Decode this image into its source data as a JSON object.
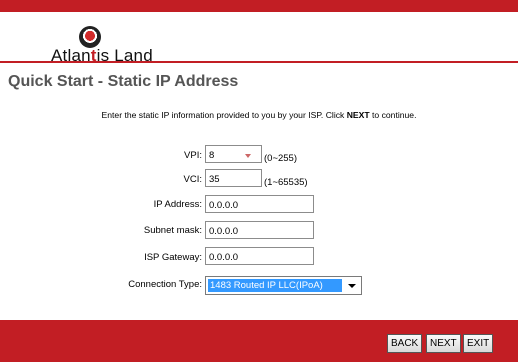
{
  "brand": {
    "name_part1": "Atlan",
    "name_accent": "t",
    "name_part2": "is Land"
  },
  "page_title": "Quick Start - Static IP Address",
  "instructions": {
    "before_bold": "Enter the static IP information provided to you by your ISP. Click ",
    "bold": "NEXT",
    "after_bold": " to continue."
  },
  "form": {
    "vpi": {
      "label": "VPI:",
      "value": "8",
      "hint": "(0~255)"
    },
    "vci": {
      "label": "VCI:",
      "value": "35",
      "hint": "(1~65535)"
    },
    "ip_address": {
      "label": "IP Address:",
      "value": "0.0.0.0"
    },
    "subnet_mask": {
      "label": "Subnet mask:",
      "value": "0.0.0.0"
    },
    "isp_gateway": {
      "label": "ISP Gateway:",
      "value": "0.0.0.0"
    },
    "connection_type": {
      "label": "Connection Type:",
      "selected": "1483 Routed IP LLC(IPoA)"
    }
  },
  "buttons": {
    "back": "BACK",
    "next": "NEXT",
    "exit": "EXIT"
  },
  "colors": {
    "brand_red": "#c21e24",
    "selection_blue": "#3399ff",
    "title_gray": "#555555"
  }
}
